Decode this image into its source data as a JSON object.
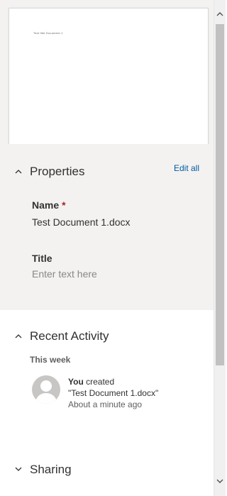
{
  "preview": {
    "document_text": "Test title Document 1"
  },
  "properties": {
    "title": "Properties",
    "edit_all": "Edit all",
    "name_label": "Name",
    "name_required": "*",
    "name_value": "Test Document 1.docx",
    "title_label": "Title",
    "title_placeholder": "Enter text here"
  },
  "recent_activity": {
    "title": "Recent Activity",
    "period": "This week",
    "items": [
      {
        "actor": "You",
        "action": "created",
        "target": "\"Test Document 1.docx\"",
        "time": "About a minute ago"
      }
    ]
  },
  "sharing": {
    "title": "Sharing"
  },
  "colors": {
    "accent_link": "#005a9e",
    "required": "#a4262c",
    "section_bg": "#f3f2f1"
  },
  "icons": {
    "properties_chevron": "chevron-up-icon",
    "activity_chevron": "chevron-up-icon",
    "sharing_chevron": "chevron-down-icon",
    "avatar": "person-icon"
  }
}
